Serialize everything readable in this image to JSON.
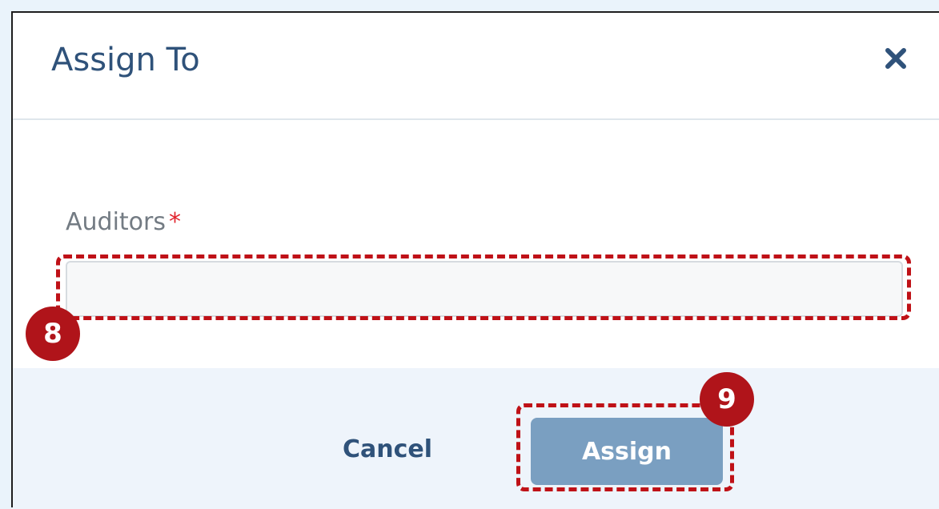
{
  "dialog": {
    "title": "Assign To",
    "close_icon": "close-icon"
  },
  "form": {
    "auditors": {
      "label": "Auditors",
      "required_marker": "*",
      "value": "",
      "placeholder": ""
    }
  },
  "footer": {
    "cancel_label": "Cancel",
    "assign_label": "Assign"
  },
  "annotations": {
    "step_8": "8",
    "step_9": "9"
  },
  "colors": {
    "title": "#2f527a",
    "assign_button": "#7a9fc1",
    "callout": "#bf1117",
    "footer_background": "#eef4fb",
    "required": "#e2232d"
  }
}
